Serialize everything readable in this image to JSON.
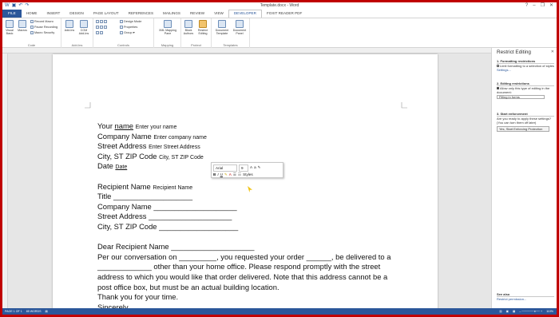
{
  "window": {
    "title": "Template.docx - Word",
    "controls": [
      "?",
      "–",
      "❐",
      "✕"
    ]
  },
  "tabs": [
    "FILE",
    "HOME",
    "INSERT",
    "DESIGN",
    "PAGE LAYOUT",
    "REFERENCES",
    "MAILINGS",
    "REVIEW",
    "VIEW",
    "DEVELOPER",
    "FOXIT READER PDF"
  ],
  "ribbon": {
    "code": {
      "label": "Code",
      "visual_basic": "Visual Basic",
      "macros": "Macros",
      "record_macro": "Record Macro",
      "pause_recording": "Pause Recording",
      "macro_security": "Macro Security"
    },
    "addins": {
      "label": "Add-Ins",
      "add_ins": "Add-Ins",
      "com_add_ins": "COM Add-Ins"
    },
    "controls": {
      "label": "Controls",
      "design_mode": "Design Mode",
      "properties": "Properties",
      "group": "Group ▾"
    },
    "mapping": {
      "label": "Mapping",
      "xml_mapping_pane": "XML Mapping Pane"
    },
    "protect": {
      "label": "Protect",
      "block_authors": "Block Authors",
      "restrict_editing": "Restrict Editing"
    },
    "templates": {
      "label": "Templates",
      "document_template": "Document Template",
      "document_panel": "Document Panel"
    }
  },
  "document": {
    "your_name_label": "Your ",
    "name_word": "name",
    "your_name_hint": "Enter your name",
    "company_label": "Company Name",
    "company_hint": "Enter company name",
    "street_label": "Street Address",
    "street_hint": "Enter Street Address",
    "city_label": "City, ST ZIP Code",
    "city_hint": "City, ST ZIP Code",
    "date_label": "Date",
    "date_hint": "Date",
    "recipient_label": "Recipient Name",
    "recipient_hint": "Recipient Name",
    "title_line": "Title ___________________",
    "company_line": "Company Name ____________________",
    "street_line": "Street Address ____________________",
    "city_line": "City, ST ZIP Code ___________________",
    "salutation": "Dear Recipient Name ____________________",
    "body": "Per our conversation on _________, you requested your order ______, be delivered to a _____________ other than your home office. Please respond promptly with the street address to which you would like that order delivered. Note that this address cannot be a post office box, but must be an actual building location.",
    "thanks": "Thank you for your time.",
    "closing": "Sincerely,"
  },
  "mini_toolbar": {
    "font": "Arial",
    "size": "9",
    "styles": "Styles",
    "bold": "B",
    "italic": "I",
    "underline": "U"
  },
  "restrict_pane": {
    "title": "Restrict Editing",
    "sec1_title": "1. Formatting restrictions",
    "sec1_option": "Limit formatting to a selection of styles",
    "sec1_link": "Settings...",
    "sec2_title": "2. Editing restrictions",
    "sec2_option": "Allow only this type of editing in the document:",
    "sec2_select": "Filling in forms",
    "sec3_title": "3. Start enforcement",
    "sec3_text": "Are you ready to apply these settings? (You can turn them off later)",
    "sec3_button": "Yes, Start Enforcing Protection",
    "see_also": "See also",
    "restrict_permission": "Restrict permission..."
  },
  "status": {
    "page": "PAGE 1 OF 1",
    "words": "85 WORDS",
    "zoom": "110%"
  },
  "colors": {
    "accent": "#2b579a",
    "frame": "#c00000"
  }
}
